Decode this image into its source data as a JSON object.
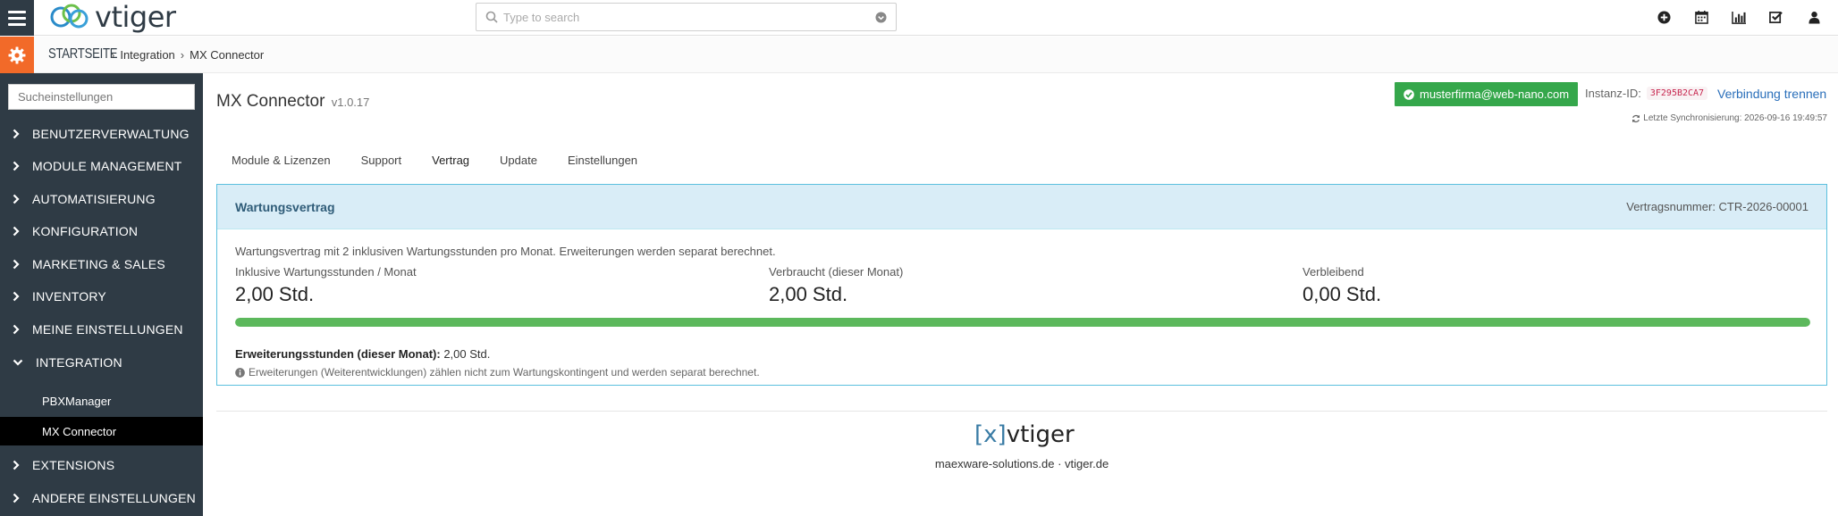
{
  "app": {
    "logo_text": "vtiger"
  },
  "search": {
    "placeholder": "Type to search"
  },
  "breadcrumb": {
    "home": "STARTSEITE",
    "items": [
      "Integration",
      "MX Connector"
    ]
  },
  "sidebar": {
    "search_placeholder": "Sucheinstellungen",
    "items": [
      {
        "label": "BENUTZERVERWALTUNG"
      },
      {
        "label": "MODULE MANAGEMENT"
      },
      {
        "label": "AUTOMATISIERUNG"
      },
      {
        "label": "KONFIGURATION"
      },
      {
        "label": "MARKETING & SALES"
      },
      {
        "label": "INVENTORY"
      },
      {
        "label": "MEINE EINSTELLUNGEN"
      },
      {
        "label": "INTEGRATION",
        "expanded": true
      },
      {
        "label": "EXTENSIONS"
      },
      {
        "label": "ANDERE EINSTELLUNGEN"
      }
    ],
    "subitems": [
      {
        "label": "PBXManager"
      },
      {
        "label": "MX Connector",
        "active": true
      }
    ]
  },
  "header": {
    "title": "MX Connector",
    "version": "v1.0.17",
    "account": "musterfirma@web-nano.com",
    "instanz_label": "Instanz-ID:",
    "instanz_id": "3F295B2CA7",
    "disconnect": "Verbindung trennen",
    "sync": "Letzte Synchronisierung: 2026-09-16 19:49:57"
  },
  "tabs": [
    {
      "label": "Module & Lizenzen"
    },
    {
      "label": "Support"
    },
    {
      "label": "Vertrag",
      "active": true
    },
    {
      "label": "Update"
    },
    {
      "label": "Einstellungen"
    }
  ],
  "contract": {
    "title": "Wartungsvertrag",
    "number": "Vertragsnummer: CTR-2026-00001",
    "description": "Wartungsvertrag mit 2 inklusiven Wartungsstunden pro Monat. Erweiterungen werden separat berechnet.",
    "stats": [
      {
        "label": "Inklusive Wartungsstunden / Monat",
        "value": "2,00 Std."
      },
      {
        "label": "Verbraucht (dieser Monat)",
        "value": "2,00 Std."
      },
      {
        "label": "Verbleibend",
        "value": "0,00 Std."
      }
    ],
    "usage_percent": 100,
    "extension_label": "Erweiterungsstunden (dieser Monat):",
    "extension_value": "2,00 Std.",
    "note": "Erweiterungen (Weiterentwicklungen) zählen nicht zum Wartungskontingent und werden separat berechnet."
  },
  "footer": {
    "logo_bracket": "[x]",
    "logo_text": "vtiger",
    "links": "maexware-solutions.de · vtiger.de"
  },
  "colors": {
    "accent": "#f26a29",
    "sidebar": "#2f3b45",
    "success": "#35a74b",
    "info_border": "#5bc0de",
    "link": "#2a6fba"
  }
}
